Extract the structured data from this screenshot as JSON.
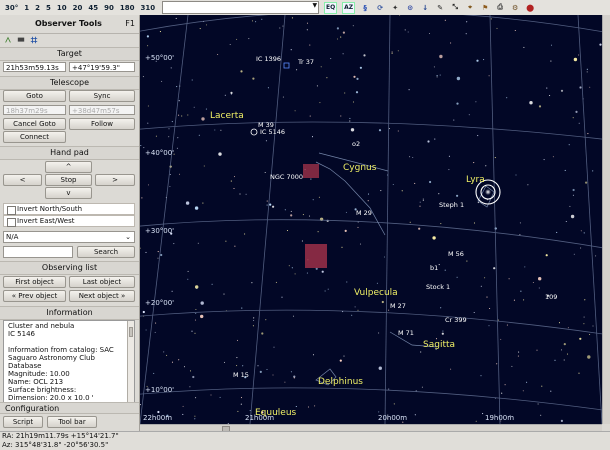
{
  "toolbar": {
    "fov_values": [
      "30°",
      "1",
      "2",
      "5",
      "10",
      "20",
      "45",
      "90",
      "180",
      "310"
    ],
    "search_placeholder": "",
    "icons": [
      "equatorial-grid-icon",
      "alt-az-grid-icon",
      "constellation-lines-icon",
      "refresh-icon",
      "stars-icon",
      "planet-icon",
      "comet-icon",
      "nebula-icon",
      "horizon-icon",
      "compass-icon",
      "telescope-icon",
      "print-icon",
      "settings-icon",
      "stop-icon"
    ],
    "eq_label": "EQ",
    "az_label": "AZ"
  },
  "sidebar": {
    "title": "Observer Tools",
    "shortcut": "F1",
    "target": {
      "section": "Target",
      "ra": "21h53m59.13s",
      "dec": "+47°19'59.3\""
    },
    "telescope": {
      "section": "Telescope",
      "goto": "Goto",
      "sync": "Sync",
      "ra": "18h37m29s",
      "dec": "+38d47m57s",
      "cancel_goto": "Cancel Goto",
      "follow": "Follow",
      "connect": "Connect"
    },
    "handpad": {
      "section": "Hand pad",
      "up": "^",
      "left": "<",
      "stop": "Stop",
      "right": ">",
      "down": "v"
    },
    "options": {
      "invert_ns": "Invert North/South",
      "invert_ew": "Invert East/West",
      "dropdown": "N/A",
      "search": "Search"
    },
    "observing": {
      "section": "Observing list",
      "first": "First object",
      "last": "Last object",
      "prev": "« Prev object",
      "next": "Next object »"
    },
    "information": {
      "section": "Information",
      "lines": [
        "Cluster and nebula",
        "IC 5146",
        "",
        "Information from catalog: SAC",
        "Saguaro Astronomy Club Database",
        "Magnitude: 10.00",
        "Name:  OCL  213",
        "Surface brightness:",
        "Dimension:  20.0 x 10.0 '"
      ]
    },
    "configuration": {
      "section": "Configuration",
      "script": "Script",
      "toolbar": "Tool bar"
    }
  },
  "status": {
    "line1": "RA: 21h19m11.79s +15°14'21.7\"",
    "line2": "Az: 315°48'31.8\" -20°56'30.5\""
  },
  "sky": {
    "dec_labels": [
      "+50°00'",
      "+40°00'",
      "+30°00'",
      "+20°00'",
      "+10°00'"
    ],
    "ra_labels": [
      "22h00m",
      "21h00m",
      "20h00m",
      "19h00m"
    ],
    "constellations": [
      "Lacerta",
      "Cygnus",
      "Lyra",
      "Vulpecula",
      "Sagitta",
      "Delphinus",
      "Equuleus"
    ],
    "objects": [
      "IC 1396",
      "Tr 37",
      "M 39",
      "IC 5146",
      "NGC 7000",
      "M 29",
      "Steph 1",
      "M 56",
      "Stock 1",
      "M 27",
      "Cr 399",
      "M 71",
      "M 15",
      "109",
      "b1",
      "o2"
    ],
    "colors": {
      "sky_background": "#020726",
      "grid": "#5f6c8f",
      "constellation_label": "#f0f066",
      "object_label": "#ffffff",
      "target_marker": "#ffffff",
      "nebula_marker": "#b2364d"
    }
  }
}
